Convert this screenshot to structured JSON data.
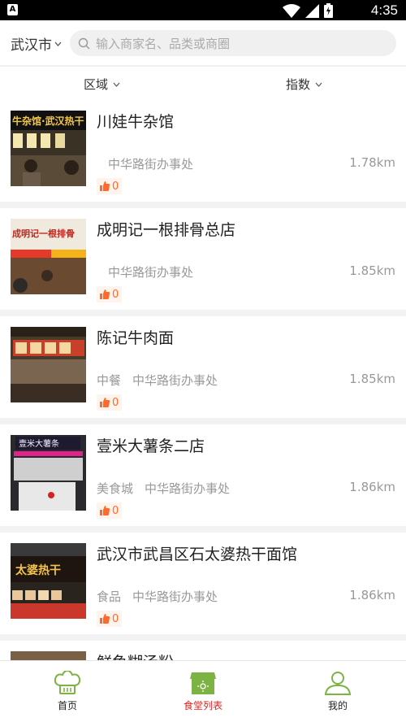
{
  "status_bar": {
    "app_badge": "A",
    "time": "4:35"
  },
  "header": {
    "city": "武汉市",
    "search_placeholder": "输入商家名、品类或商圈"
  },
  "filters": [
    {
      "label": "区域"
    },
    {
      "label": "指数"
    }
  ],
  "restaurants": [
    {
      "name": "川娃牛杂馆",
      "category": "",
      "district": "中华路街办事处",
      "distance": "1.78km",
      "likes": "0",
      "sign_text": "牛杂馆·武汉热干"
    },
    {
      "name": "成明记一根排骨总店",
      "category": "",
      "district": "中华路街办事处",
      "distance": "1.85km",
      "likes": "0",
      "sign_text": "成明记一根排骨"
    },
    {
      "name": "陈记牛肉面",
      "category": "中餐",
      "district": "中华路街办事处",
      "distance": "1.85km",
      "likes": "0",
      "sign_text": ""
    },
    {
      "name": "壹米大薯条二店",
      "category": "美食城",
      "district": "中华路街办事处",
      "distance": "1.86km",
      "likes": "0",
      "sign_text": "壹米大薯条"
    },
    {
      "name": "武汉市武昌区石太婆热干面馆",
      "category": "食品",
      "district": "中华路街办事处",
      "distance": "1.86km",
      "likes": "0",
      "sign_text": "太婆热干"
    },
    {
      "name": "鲜鱼糊汤粉",
      "category": "",
      "district": "",
      "distance": "",
      "likes": "",
      "sign_text": ""
    }
  ],
  "tabbar": [
    {
      "label": "首页",
      "icon": "chef-hat-icon"
    },
    {
      "label": "食堂列表",
      "icon": "canteen-list-icon",
      "active": true
    },
    {
      "label": "我的",
      "icon": "user-icon"
    }
  ],
  "colors": {
    "accent": "#e02020",
    "brand_green": "#7cb342",
    "like": "#ff6a2a"
  }
}
